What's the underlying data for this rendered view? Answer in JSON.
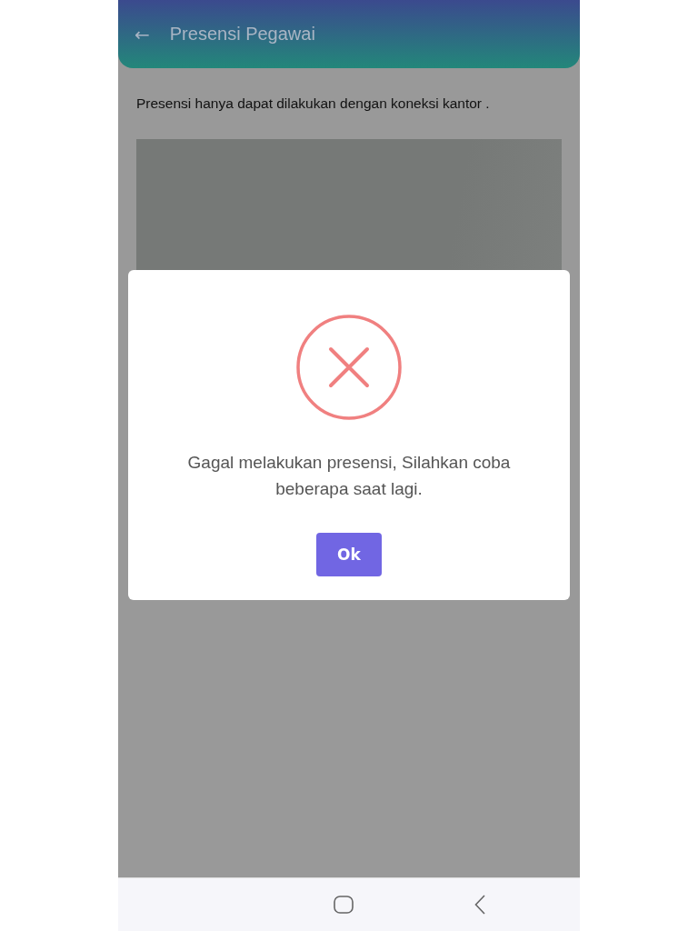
{
  "header": {
    "back_icon": "←",
    "title": "Presensi Pegawai"
  },
  "notice": "Presensi hanya dapat dilakukan dengan koneksi kantor .",
  "dialog": {
    "failed": true,
    "message": "Gagal melakukan presensi, Silahkan coba beberapa saat lagi.",
    "button": "Ok"
  }
}
